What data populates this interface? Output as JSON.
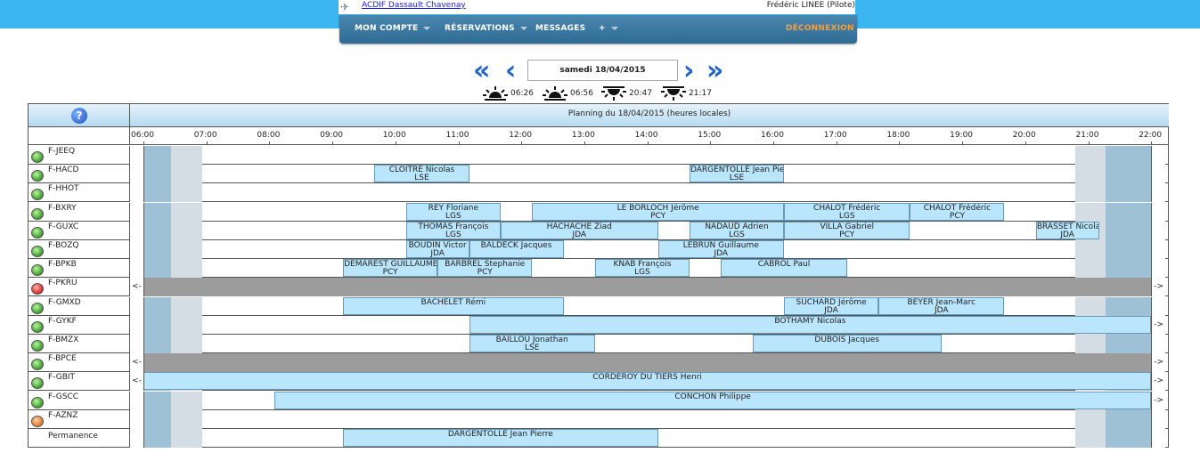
{
  "header": {
    "club_link": "ACDIF Dassault Chavenay",
    "user": "Frédéric LINEE (Pilote)"
  },
  "menu": {
    "account": "MON COMPTE",
    "reservations": "RÉSERVATIONS",
    "messages": "MESSAGES",
    "plus": "+",
    "logout": "DÉCONNEXION"
  },
  "nav": {
    "date": "samedi 18/04/2015",
    "prev_fast": "«",
    "prev": "‹",
    "next": "›",
    "next_fast": "»"
  },
  "sun": {
    "times": [
      "06:26",
      "06:56",
      "20:47",
      "21:17"
    ],
    "icons": [
      "dawn-icon",
      "sunrise-icon",
      "sunset-icon",
      "dusk-icon"
    ]
  },
  "planning": {
    "help_icon": "?",
    "title": "Planning du 18/04/2015 (heures locales)",
    "hours": [
      "06:00",
      "07:00",
      "08:00",
      "09:00",
      "10:00",
      "11:00",
      "12:00",
      "13:00",
      "14:00",
      "15:00",
      "16:00",
      "17:00",
      "18:00",
      "19:00",
      "20:00",
      "21:00",
      "22:00"
    ],
    "rows": [
      {
        "label": "F-JEEQ",
        "status": "green",
        "bookings": []
      },
      {
        "label": "F-HACD",
        "status": "green",
        "bookings": [
          {
            "start": 9.67,
            "end": 11.17,
            "name": "CLOITRE Nicolas",
            "code": "LSE"
          },
          {
            "start": 14.67,
            "end": 16.17,
            "name": "DARGENTOLLE Jean Pierre",
            "code": "LSE"
          }
        ]
      },
      {
        "label": "F-HHOT",
        "status": "green",
        "bookings": []
      },
      {
        "label": "F-BXRY",
        "status": "green",
        "bookings": [
          {
            "start": 10.17,
            "end": 11.67,
            "name": "REY Floriane",
            "code": "LGS"
          },
          {
            "start": 12.17,
            "end": 16.17,
            "name": "LE BORLOCH Jérôme",
            "code": "PCY"
          },
          {
            "start": 16.17,
            "end": 18.17,
            "name": "CHALOT Frédéric",
            "code": "LGS"
          },
          {
            "start": 18.17,
            "end": 19.67,
            "name": "CHALOT Frédéric",
            "code": "PCY"
          }
        ]
      },
      {
        "label": "F-GUXC",
        "status": "green",
        "bookings": [
          {
            "start": 10.17,
            "end": 11.67,
            "name": "THOMAS François",
            "code": "LGS"
          },
          {
            "start": 11.67,
            "end": 14.17,
            "name": "HACHACHE Ziad",
            "code": "JDA"
          },
          {
            "start": 14.67,
            "end": 16.17,
            "name": "NADAUD Adrien",
            "code": "LGS"
          },
          {
            "start": 16.17,
            "end": 18.17,
            "name": "VILLA Gabriel",
            "code": "PCY"
          },
          {
            "start": 20.17,
            "end": 21.17,
            "name": "BRASSET Nicolas",
            "code": "JDA"
          }
        ]
      },
      {
        "label": "F-BOZQ",
        "status": "green",
        "bookings": [
          {
            "start": 10.17,
            "end": 11.17,
            "name": "BOUDIN Victor",
            "code": "JDA"
          },
          {
            "start": 11.17,
            "end": 12.67,
            "name": "BALDECK Jacques",
            "code": ""
          },
          {
            "start": 14.17,
            "end": 16.17,
            "name": "LEBRUN Guillaume",
            "code": "JDA"
          }
        ]
      },
      {
        "label": "F-BPKB",
        "status": "green",
        "bookings": [
          {
            "start": 9.17,
            "end": 10.67,
            "name": "DEMAREST GUILLAUME",
            "code": "PCY"
          },
          {
            "start": 10.67,
            "end": 12.17,
            "name": "BARBREL Stephanie",
            "code": "PCY"
          },
          {
            "start": 13.17,
            "end": 14.67,
            "name": "KNAB François",
            "code": "LGS"
          },
          {
            "start": 15.17,
            "end": 17.17,
            "name": "CABROL Paul",
            "code": ""
          }
        ]
      },
      {
        "label": "F-PKRU",
        "status": "red",
        "unavailable": true,
        "edges": [
          "<-",
          "->"
        ],
        "bookings": []
      },
      {
        "label": "F-GMXD",
        "status": "green",
        "bookings": [
          {
            "start": 9.17,
            "end": 12.67,
            "name": "BACHELET Rémi",
            "code": ""
          },
          {
            "start": 16.17,
            "end": 17.67,
            "name": "SUCHARD Jérôme",
            "code": "JDA"
          },
          {
            "start": 17.67,
            "end": 19.67,
            "name": "BEYER Jean-Marc",
            "code": "JDA"
          }
        ]
      },
      {
        "label": "F-GYKF",
        "status": "green",
        "edges": [
          "",
          "->"
        ],
        "bookings": [
          {
            "start": 11.17,
            "end": 22.0,
            "name": "BOTHAMY Nicolas",
            "code": ""
          }
        ]
      },
      {
        "label": "F-BMZX",
        "status": "green",
        "bookings": [
          {
            "start": 11.17,
            "end": 13.17,
            "name": "BAILLOU Jonathan",
            "code": "LSE"
          },
          {
            "start": 15.67,
            "end": 18.67,
            "name": "DUBOIS Jacques",
            "code": ""
          }
        ]
      },
      {
        "label": "F-BPCE",
        "status": "green",
        "unavailable": true,
        "edges": [
          "<-",
          "->"
        ],
        "bookings": []
      },
      {
        "label": "F-GBIT",
        "status": "green",
        "edges": [
          "<-",
          "->"
        ],
        "bookings": [
          {
            "start": 6.0,
            "end": 22.0,
            "name": "CORDEROY DU TIERS Henri",
            "code": ""
          }
        ]
      },
      {
        "label": "F-GSCC",
        "status": "green",
        "edges": [
          "",
          "->"
        ],
        "bookings": [
          {
            "start": 8.08,
            "end": 22.0,
            "name": "CONCHON Philippe",
            "code": ""
          }
        ]
      },
      {
        "label": "F-AZNZ",
        "status": "orange",
        "bookings": []
      },
      {
        "label": "Permanence",
        "status": "",
        "bookings": [
          {
            "start": 9.17,
            "end": 14.17,
            "name": "DARGENTOLLE Jean Pierre",
            "code": ""
          }
        ]
      }
    ]
  }
}
